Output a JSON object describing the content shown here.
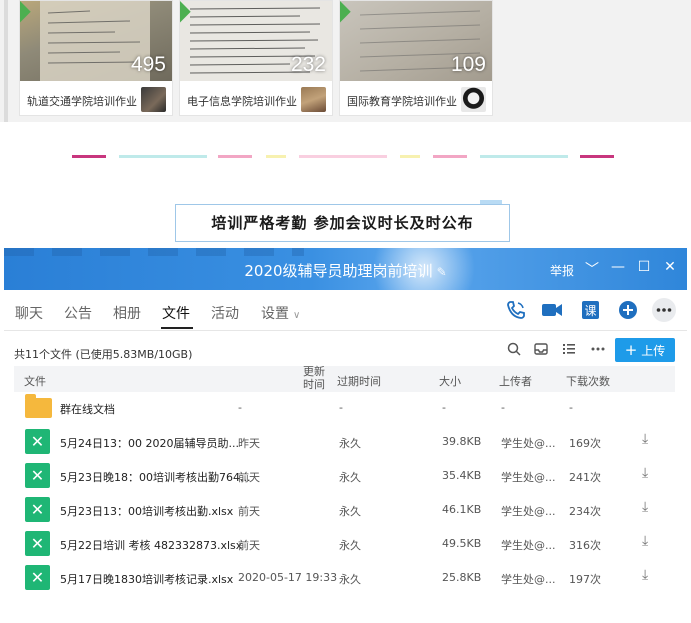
{
  "albums": [
    {
      "name": "轨道交通学院培训作业",
      "count": "495"
    },
    {
      "name": "电子信息学院培训作业",
      "count": "232"
    },
    {
      "name": "国际教育学院培训作业",
      "count": "109"
    }
  ],
  "caption": "培训严格考勤 参加会议时长及时公布",
  "window": {
    "title": "2020级辅导员助理岗前培训",
    "report": "举报",
    "controls": [
      "﹀",
      "—",
      "☐",
      "✕"
    ]
  },
  "tabs": [
    "聊天",
    "公告",
    "相册",
    "文件",
    "活动",
    "设置"
  ],
  "active_tab": "文件",
  "file_summary": "共11个文件 (已使用5.83MB/10GB)",
  "upload_label": "上传",
  "columns": {
    "file": "文件",
    "updated": "更新时间",
    "expire": "过期时间",
    "size": "大小",
    "uploader": "上传者",
    "downloads": "下载次数"
  },
  "files": [
    {
      "name": "群在线文档",
      "updated": "-",
      "expire": "-",
      "size": "-",
      "uploader": "-",
      "downloads": "-",
      "type": "folder"
    },
    {
      "name": "5月24日13：00  2020届辅导员助...",
      "updated": "昨天",
      "expire": "永久",
      "size": "39.8KB",
      "uploader": "学生处@...",
      "downloads": "169次",
      "type": "xlsx"
    },
    {
      "name": "5月23日晚18：00培训考核出勤764...",
      "updated": "前天",
      "expire": "永久",
      "size": "35.4KB",
      "uploader": "学生处@...",
      "downloads": "241次",
      "type": "xlsx"
    },
    {
      "name": "5月23日13：00培训考核出勤.xlsx",
      "updated": "前天",
      "expire": "永久",
      "size": "46.1KB",
      "uploader": "学生处@...",
      "downloads": "234次",
      "type": "xlsx"
    },
    {
      "name": "5月22日培训 考核 482332873.xlsx",
      "updated": "前天",
      "expire": "永久",
      "size": "49.5KB",
      "uploader": "学生处@...",
      "downloads": "316次",
      "type": "xlsx"
    },
    {
      "name": "5月17日晚1830培训考核记录.xlsx",
      "updated": "2020-05-17 19:33",
      "expire": "永久",
      "size": "25.8KB",
      "uploader": "学生处@...",
      "downloads": "197次",
      "type": "xlsx"
    }
  ],
  "colors": {
    "title_bar": "#2f86da",
    "upload_button": "#1e9be9",
    "excel_icon": "#1fb675",
    "folder_icon": "#f5b83d",
    "caption_border": "#9fc7e8"
  },
  "icons": {
    "call": "phone-icon",
    "video": "video-icon",
    "course": "course-icon",
    "add": "plus-circle-icon",
    "more": "more-icon",
    "search": "search-icon",
    "inbox": "inbox-icon",
    "list": "list-view-icon",
    "download": "download-icon"
  }
}
